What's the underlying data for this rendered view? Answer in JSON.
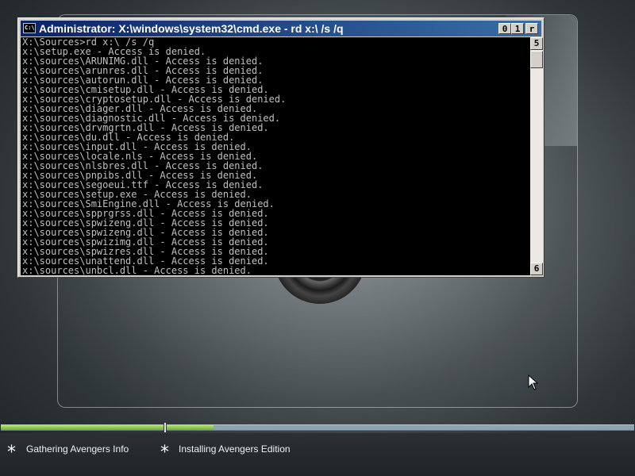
{
  "window": {
    "title": "Administrator: X:\\windows\\system32\\cmd.exe - rd  x:\\ /s /q",
    "icon_label": "C:\\",
    "buttons": {
      "minimize": "0",
      "maximize": "1",
      "close": "r"
    }
  },
  "console": {
    "lines": [
      "X:\\Sources>rd x:\\ /s /q",
      "x:\\setup.exe - Access is denied.",
      "x:\\sources\\ARUNIMG.dll - Access is denied.",
      "x:\\sources\\arunres.dll - Access is denied.",
      "x:\\sources\\autorun.dll - Access is denied.",
      "x:\\sources\\cmisetup.dll - Access is denied.",
      "x:\\sources\\cryptosetup.dll - Access is denied.",
      "x:\\sources\\diager.dll - Access is denied.",
      "x:\\sources\\diagnostic.dll - Access is denied.",
      "x:\\sources\\drvmgrtn.dll - Access is denied.",
      "x:\\sources\\du.dll - Access is denied.",
      "x:\\sources\\input.dll - Access is denied.",
      "x:\\sources\\locale.nls - Access is denied.",
      "x:\\sources\\nlsbres.dll - Access is denied.",
      "x:\\sources\\pnpibs.dll - Access is denied.",
      "x:\\sources\\segoeui.ttf - Access is denied.",
      "x:\\sources\\setup.exe - Access is denied.",
      "x:\\sources\\SmiEngine.dll - Access is denied.",
      "x:\\sources\\spprgrss.dll - Access is denied.",
      "x:\\sources\\spwizeng.dll - Access is denied.",
      "x:\\sources\\spwizeng.dll - Access is denied.",
      "x:\\sources\\spwizimg.dll - Access is denied.",
      "x:\\sources\\spwizres.dll - Access is denied.",
      "x:\\sources\\unattend.dll - Access is denied.",
      "x:\\sources\\unbcl.dll - Access is denied."
    ]
  },
  "scrollbar": {
    "up_glyph": "5",
    "down_glyph": "6"
  },
  "progress": {
    "steps": [
      {
        "label": "Gathering Avengers Info",
        "bullet": "*",
        "fill_fraction": 1.0
      },
      {
        "label": "Installing Avengers Edition",
        "bullet": "*",
        "fill_fraction": 0.1
      }
    ]
  },
  "colors": {
    "titlebar_start": "#0a246a",
    "titlebar_end": "#3a6ea5",
    "console_bg": "#000000",
    "console_text": "#c0c0c0",
    "progress_fill": "#71b02e",
    "progress_track": "#8ea3b0"
  }
}
